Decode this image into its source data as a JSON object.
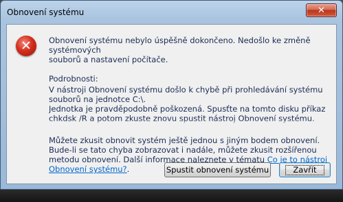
{
  "window": {
    "title": "Obnovení systému",
    "close_glyph": "✕"
  },
  "icon": "error-icon",
  "message": {
    "main_line1": "Obnovení systému nebylo úspěšně dokončeno. Nedošlo ke změně systémových",
    "main_line2": "souborů a nastavení počítače.",
    "details_label": "Podrobnosti:",
    "details_text_1": "V nástroji Obnovení systému došlo k chybě při prohledávání systému souborů na jednotce C:\\.",
    "details_text_2": "Jednotka je pravděpodobně poškozená. Spusťte na tomto disku příkaz chkdsk /R a potom zkuste znovu spustit nástroj Obnovení systému.",
    "info_text": "Můžete zkusit obnovit systém ještě jednou s jiným bodem obnovení. Bude-li se tato chyba zobrazovat i nadále, můžete zkusit rozšířenou metodu obnovení. Další informace naleznete v tématu ",
    "help_link": "Co je to nástroj Obnovení systému?",
    "info_suffix": "."
  },
  "buttons": {
    "restore_label": "Spustit obnovení systému",
    "close_label": "Zavřít"
  }
}
